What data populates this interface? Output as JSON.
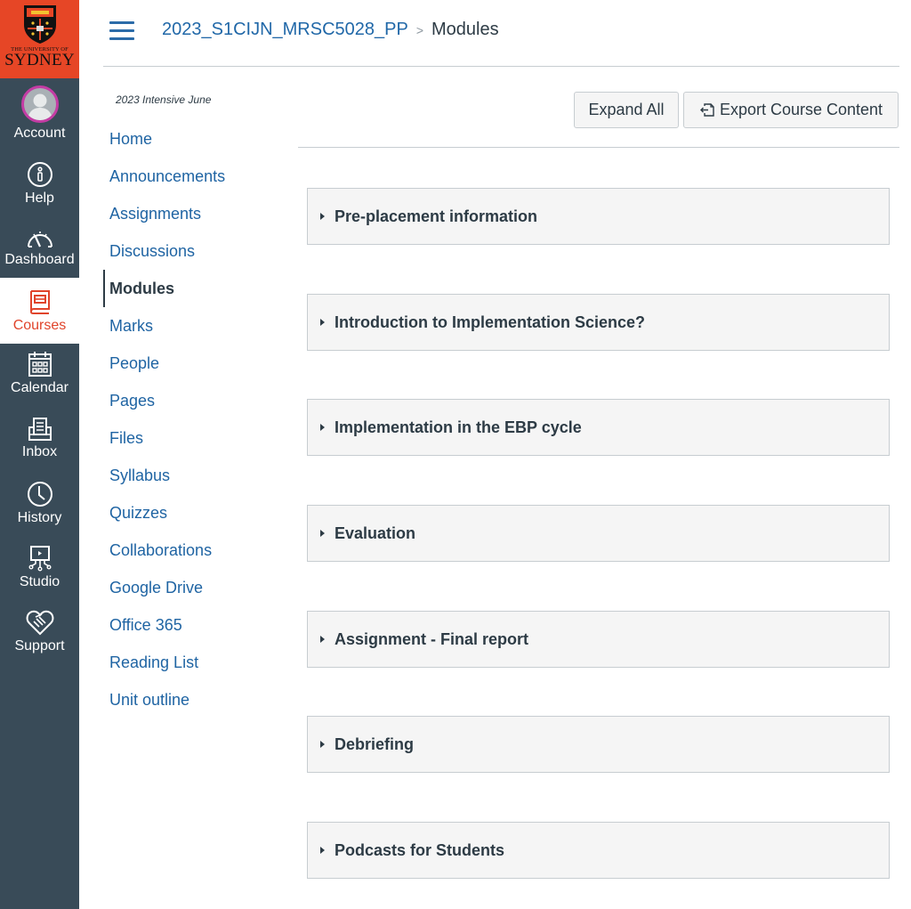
{
  "brand": {
    "small_text": "THE UNIVERSITY OF",
    "big_text": "SYDNEY",
    "color": "#e64626"
  },
  "global_nav": {
    "background": "#394b58",
    "active_color": "#e0442b",
    "items": [
      {
        "label": "Account",
        "icon": "avatar-icon"
      },
      {
        "label": "Help",
        "icon": "info-icon"
      },
      {
        "label": "Dashboard",
        "icon": "dashboard-gauge-icon"
      },
      {
        "label": "Courses",
        "icon": "book-icon",
        "active": true
      },
      {
        "label": "Calendar",
        "icon": "calendar-icon"
      },
      {
        "label": "Inbox",
        "icon": "inbox-icon"
      },
      {
        "label": "History",
        "icon": "clock-icon"
      },
      {
        "label": "Studio",
        "icon": "studio-icon"
      },
      {
        "label": "Support",
        "icon": "handshake-heart-icon"
      }
    ]
  },
  "header": {
    "breadcrumb_course": "2023_S1CIJN_MRSC5028_PP",
    "breadcrumb_separator": ">",
    "breadcrumb_current": "Modules"
  },
  "course_nav": {
    "term": "2023 Intensive June",
    "items": [
      {
        "label": "Home"
      },
      {
        "label": "Announcements"
      },
      {
        "label": "Assignments"
      },
      {
        "label": "Discussions"
      },
      {
        "label": "Modules",
        "active": true
      },
      {
        "label": "Marks"
      },
      {
        "label": "People"
      },
      {
        "label": "Pages"
      },
      {
        "label": "Files"
      },
      {
        "label": "Syllabus"
      },
      {
        "label": "Quizzes"
      },
      {
        "label": "Collaborations"
      },
      {
        "label": "Google Drive"
      },
      {
        "label": "Office 365"
      },
      {
        "label": "Reading List"
      },
      {
        "label": "Unit outline"
      }
    ]
  },
  "toolbar": {
    "expand_all_label": "Expand All",
    "export_label": "Export Course Content",
    "export_icon": "export-icon"
  },
  "modules": [
    {
      "title": "Pre-placement information"
    },
    {
      "title": "Introduction to Implementation Science?"
    },
    {
      "title": "Implementation in the EBP cycle"
    },
    {
      "title": "Evaluation"
    },
    {
      "title": "Assignment - Final report"
    },
    {
      "title": "Debriefing"
    },
    {
      "title": "Podcasts for Students"
    }
  ]
}
